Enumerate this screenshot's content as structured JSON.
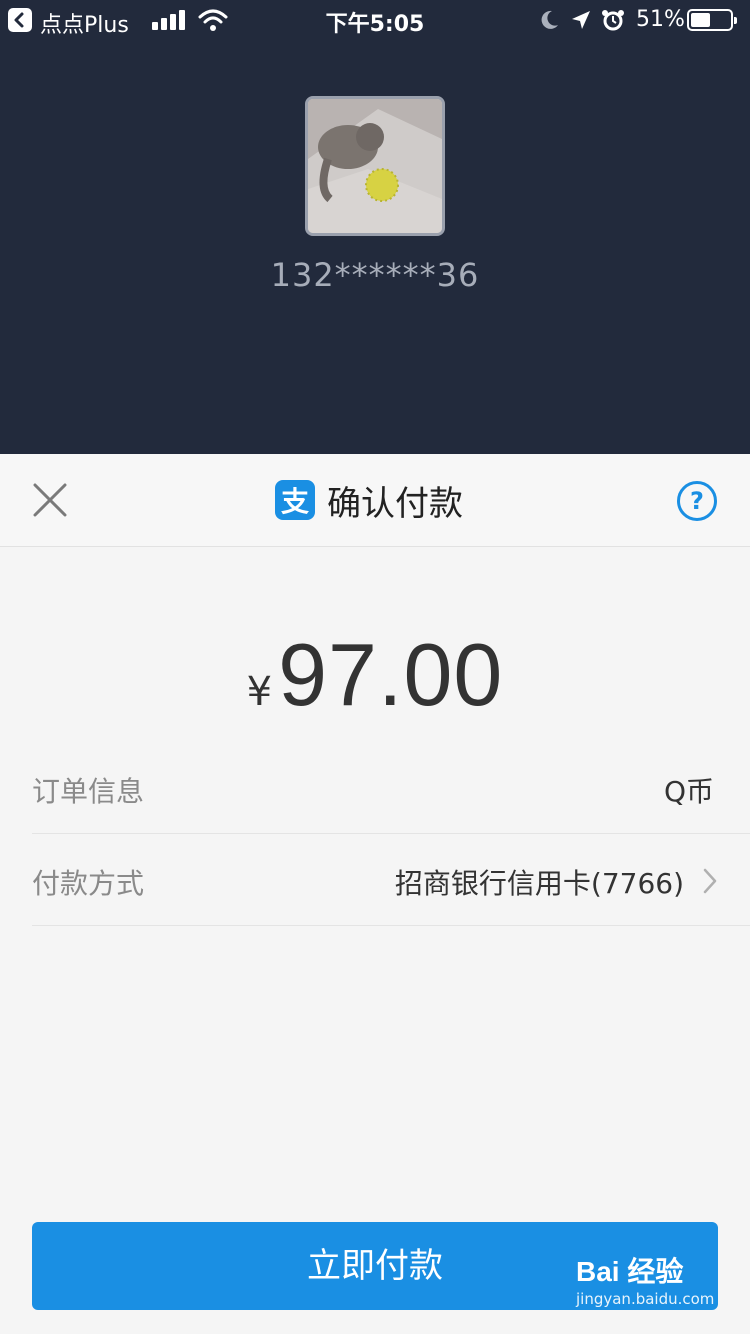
{
  "status_bar": {
    "back_app": "点点Plus",
    "time": "下午5:05",
    "battery_percent": "51%",
    "battery_level": 0.51,
    "icons": [
      "back-chevron-icon",
      "signal-icon",
      "wifi-icon",
      "moon-icon",
      "location-icon",
      "alarm-icon",
      "battery-icon"
    ]
  },
  "payee": {
    "account": "132******36"
  },
  "sheet": {
    "title": "确认付款",
    "logo_glyph": "支",
    "help_glyph": "?",
    "amount_currency": "¥",
    "amount": "97.00",
    "rows": [
      {
        "label": "订单信息",
        "value": "Q币"
      },
      {
        "label": "付款方式",
        "value": "招商银行信用卡(7766)"
      }
    ],
    "pay_button": "立即付款"
  },
  "watermark": {
    "brand": "Bai 经验",
    "url": "jingyan.baidu.com"
  },
  "colors": {
    "header_bg": "#222a3c",
    "accent": "#1a8fe3",
    "sheet_bg": "#f5f5f5"
  }
}
